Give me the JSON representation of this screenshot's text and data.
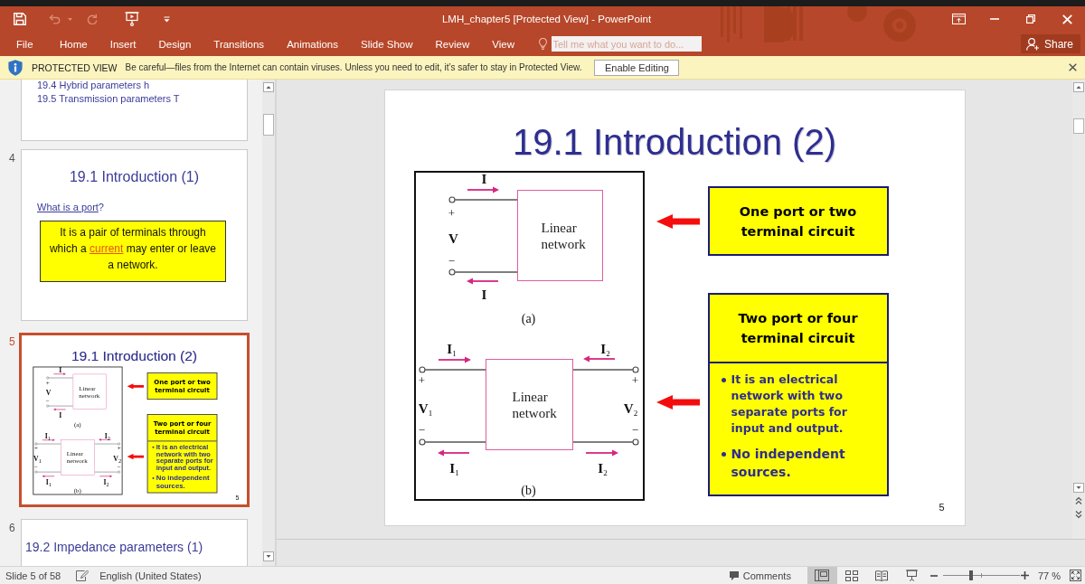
{
  "window": {
    "title": "LMH_chapter5 [Protected View] - PowerPoint"
  },
  "quick_access": [
    {
      "kind": "save",
      "disabled": false
    },
    {
      "kind": "undo",
      "disabled": true
    },
    {
      "kind": "redo",
      "disabled": true
    },
    {
      "kind": "present",
      "disabled": false
    },
    {
      "kind": "customize",
      "disabled": false
    }
  ],
  "ribbon": {
    "file": "File",
    "tabs": [
      {
        "label": "Home",
        "selected": false
      },
      {
        "label": "Insert",
        "selected": false
      },
      {
        "label": "Design",
        "selected": false
      },
      {
        "label": "Transitions",
        "selected": false
      },
      {
        "label": "Animations",
        "selected": false
      },
      {
        "label": "Slide Show",
        "selected": false
      },
      {
        "label": "Review",
        "selected": false
      },
      {
        "label": "View",
        "selected": false
      }
    ],
    "search": {
      "placeholder": "Tell me what you want to do..."
    },
    "share": "Share"
  },
  "message_bar": {
    "title": "PROTECTED VIEW",
    "message": "Be careful—files from the Internet can contain viruses. Unless you need to edit, it’s safer to stay in Protected View.",
    "button": "Enable Editing"
  },
  "thumbnails": [
    {
      "kind": "list",
      "selected": false,
      "lines": [
        "19.4 Hybrid parameters h",
        "19.5 Transmission parameters T"
      ]
    },
    {
      "kind": "text",
      "number": "4",
      "selected": false,
      "title": "19.1 Introduction (1)",
      "question": {
        "link": "What is a port",
        "after": "?"
      },
      "note": {
        "before": "It is a pair of terminals through which a ",
        "link": "current",
        "after": " may enter or leave a network."
      }
    },
    {
      "kind": "slide",
      "number": "5",
      "selected": true,
      "slide": {
        "title": "19.1 Introduction (2)",
        "figure": {
          "panels": [
            {
              "kind": "one_port",
              "current_in": "I",
              "plus": "+",
              "voltage": "V",
              "minus": "−",
              "current_out": "I",
              "network": "Linear network",
              "caption": "(a)"
            },
            {
              "kind": "two_port",
              "current_in_1": "I$_{1}$",
              "current_in_2": "I$_{2}$",
              "plus_1": "+",
              "plus_2": "+",
              "voltage_1": "V$_{1}$",
              "voltage_2": "V$_{2}$",
              "minus_1": "−",
              "minus_2": "−",
              "current_out_1": "I$_{1}$",
              "current_out_2": "I$_{2}$",
              "network": "Linear network",
              "caption": "(b)"
            }
          ]
        },
        "callouts": [
          {
            "kind": "heading",
            "heading": "One port or two terminal circuit"
          },
          {
            "kind": "detailed",
            "heading": "Two port or four terminal circuit",
            "bullets": [
              "It is an electrical network with two separate ports for input and output.",
              "No independent sources."
            ]
          }
        ],
        "number": "5"
      }
    },
    {
      "kind": "title",
      "number": "6",
      "selected": false,
      "title": "19.2 Impedance parameters (1)"
    }
  ],
  "slide": {
    "title": "19.1 Introduction (2)",
    "figure": {
      "panels": [
        {
          "kind": "one_port",
          "current_in": "I",
          "plus": "+",
          "voltage": "V",
          "minus": "−",
          "current_out": "I",
          "network": "Linear network",
          "caption": "(a)"
        },
        {
          "kind": "two_port",
          "current_in_1": "I$_{1}$",
          "current_in_2": "I$_{2}$",
          "plus_1": "+",
          "plus_2": "+",
          "voltage_1": "V$_{1}$",
          "voltage_2": "V$_{2}$",
          "minus_1": "−",
          "minus_2": "−",
          "current_out_1": "I$_{1}$",
          "current_out_2": "I$_{2}$",
          "network": "Linear network",
          "caption": "(b)"
        }
      ]
    },
    "callouts": [
      {
        "kind": "heading",
        "heading": "One port or two terminal circuit"
      },
      {
        "kind": "detailed",
        "heading": "Two port or four terminal circuit",
        "bullets": [
          "It is an electrical network with two separate ports for input and output.",
          "No independent sources."
        ]
      }
    ],
    "number": "5"
  },
  "status_bar": {
    "slide_info": "Slide 5 of 58",
    "language": "English (United States)",
    "comments": "Comments",
    "views": [
      {
        "kind": "normal",
        "selected": true
      },
      {
        "kind": "sorter",
        "selected": false
      },
      {
        "kind": "reading",
        "selected": false
      },
      {
        "kind": "slideshow",
        "selected": false
      }
    ],
    "zoom": {
      "level": 0.36,
      "reading": "77 %"
    }
  }
}
